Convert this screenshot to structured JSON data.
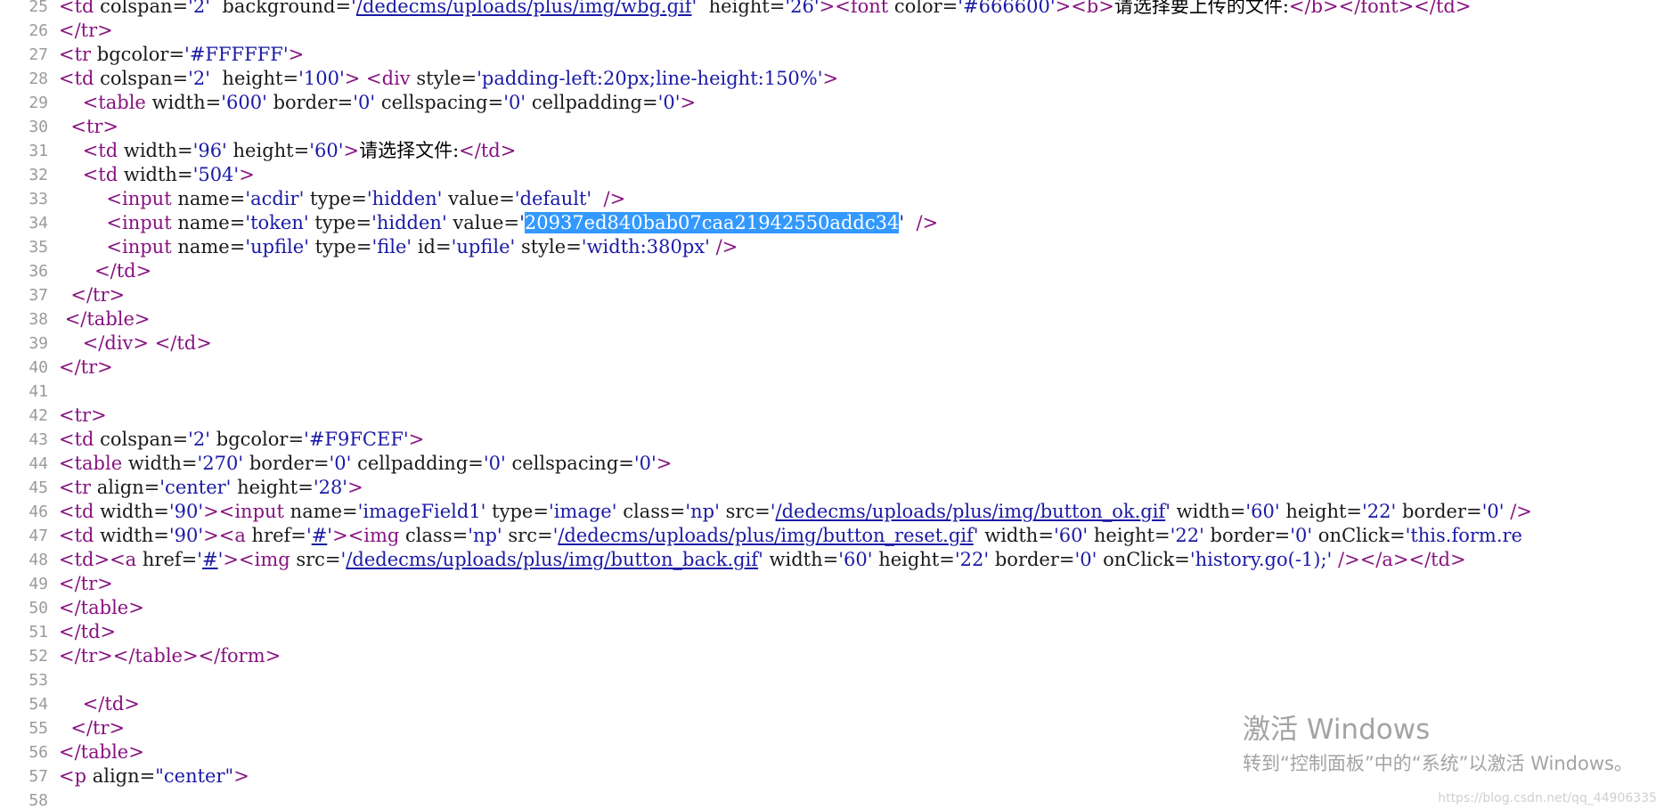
{
  "colors": {
    "tag": "#881280",
    "attribute": "#1a1a1a",
    "value": "#1a1aa6",
    "line_number": "#9a9a9a",
    "selection": "#3399ff",
    "watermark": "#a3a3a3"
  },
  "lines": [
    {
      "n": "25",
      "tokens": [
        [
          "tag",
          "<td "
        ],
        [
          "attr",
          "colspan="
        ],
        [
          "val",
          "'2'"
        ],
        [
          "text",
          "  "
        ],
        [
          "attr",
          "background="
        ],
        [
          "val",
          "'"
        ],
        [
          "link",
          "/dedecms/uploads/plus/img/wbg.gif"
        ],
        [
          "val",
          "'"
        ],
        [
          "text",
          "  "
        ],
        [
          "attr",
          "height="
        ],
        [
          "val",
          "'26'"
        ],
        [
          "tag",
          ">"
        ],
        [
          "tag",
          "<font "
        ],
        [
          "attr",
          "color="
        ],
        [
          "val",
          "'#666600'"
        ],
        [
          "tag",
          ">"
        ],
        [
          "tag",
          "<b>"
        ],
        [
          "text",
          "请选择要上传的文件:"
        ],
        [
          "tag",
          "</b>"
        ],
        [
          "tag",
          "</font>"
        ],
        [
          "tag",
          "</td>"
        ]
      ]
    },
    {
      "n": "26",
      "tokens": [
        [
          "tag",
          "</tr>"
        ]
      ]
    },
    {
      "n": "27",
      "tokens": [
        [
          "tag",
          "<tr "
        ],
        [
          "attr",
          "bgcolor="
        ],
        [
          "val",
          "'#FFFFFF'"
        ],
        [
          "tag",
          ">"
        ]
      ]
    },
    {
      "n": "28",
      "tokens": [
        [
          "tag",
          "<td "
        ],
        [
          "attr",
          "colspan="
        ],
        [
          "val",
          "'2'"
        ],
        [
          "text",
          "  "
        ],
        [
          "attr",
          "height="
        ],
        [
          "val",
          "'100'"
        ],
        [
          "tag",
          ">"
        ],
        [
          "text",
          " "
        ],
        [
          "tag",
          "<div "
        ],
        [
          "attr",
          "style="
        ],
        [
          "val",
          "'padding-left:20px;line-height:150%'"
        ],
        [
          "tag",
          ">"
        ]
      ]
    },
    {
      "n": "29",
      "tokens": [
        [
          "text",
          "    "
        ],
        [
          "tag",
          "<table "
        ],
        [
          "attr",
          "width="
        ],
        [
          "val",
          "'600'"
        ],
        [
          "text",
          " "
        ],
        [
          "attr",
          "border="
        ],
        [
          "val",
          "'0'"
        ],
        [
          "text",
          " "
        ],
        [
          "attr",
          "cellspacing="
        ],
        [
          "val",
          "'0'"
        ],
        [
          "text",
          " "
        ],
        [
          "attr",
          "cellpadding="
        ],
        [
          "val",
          "'0'"
        ],
        [
          "tag",
          ">"
        ]
      ]
    },
    {
      "n": "30",
      "tokens": [
        [
          "text",
          "  "
        ],
        [
          "tag",
          "<tr>"
        ]
      ]
    },
    {
      "n": "31",
      "tokens": [
        [
          "text",
          "    "
        ],
        [
          "tag",
          "<td "
        ],
        [
          "attr",
          "width="
        ],
        [
          "val",
          "'96'"
        ],
        [
          "text",
          " "
        ],
        [
          "attr",
          "height="
        ],
        [
          "val",
          "'60'"
        ],
        [
          "tag",
          ">"
        ],
        [
          "text",
          "请选择文件:"
        ],
        [
          "tag",
          "</td>"
        ]
      ]
    },
    {
      "n": "32",
      "tokens": [
        [
          "text",
          "    "
        ],
        [
          "tag",
          "<td "
        ],
        [
          "attr",
          "width="
        ],
        [
          "val",
          "'504'"
        ],
        [
          "tag",
          ">"
        ]
      ]
    },
    {
      "n": "33",
      "tokens": [
        [
          "text",
          "        "
        ],
        [
          "tag",
          "<input "
        ],
        [
          "attr",
          "name="
        ],
        [
          "val",
          "'acdir'"
        ],
        [
          "text",
          " "
        ],
        [
          "attr",
          "type="
        ],
        [
          "val",
          "'hidden'"
        ],
        [
          "text",
          " "
        ],
        [
          "attr",
          "value="
        ],
        [
          "val",
          "'default'"
        ],
        [
          "text",
          "  "
        ],
        [
          "tag",
          "/>"
        ]
      ]
    },
    {
      "n": "34",
      "tokens": [
        [
          "text",
          "        "
        ],
        [
          "tag",
          "<input "
        ],
        [
          "attr",
          "name="
        ],
        [
          "val",
          "'token'"
        ],
        [
          "text",
          " "
        ],
        [
          "attr",
          "type="
        ],
        [
          "val",
          "'hidden'"
        ],
        [
          "text",
          " "
        ],
        [
          "attr",
          "value="
        ],
        [
          "val",
          "'"
        ],
        [
          "sel",
          "20937ed840bab07caa21942550addc34"
        ],
        [
          "val",
          "'"
        ],
        [
          "text",
          "  "
        ],
        [
          "tag",
          "/>"
        ]
      ]
    },
    {
      "n": "35",
      "tokens": [
        [
          "text",
          "        "
        ],
        [
          "tag",
          "<input "
        ],
        [
          "attr",
          "name="
        ],
        [
          "val",
          "'upfile'"
        ],
        [
          "text",
          " "
        ],
        [
          "attr",
          "type="
        ],
        [
          "val",
          "'file'"
        ],
        [
          "text",
          " "
        ],
        [
          "attr",
          "id="
        ],
        [
          "val",
          "'upfile'"
        ],
        [
          "text",
          " "
        ],
        [
          "attr",
          "style="
        ],
        [
          "val",
          "'width:380px'"
        ],
        [
          "text",
          " "
        ],
        [
          "tag",
          "/>"
        ]
      ]
    },
    {
      "n": "36",
      "tokens": [
        [
          "text",
          "      "
        ],
        [
          "tag",
          "</td>"
        ]
      ]
    },
    {
      "n": "37",
      "tokens": [
        [
          "text",
          "  "
        ],
        [
          "tag",
          "</tr>"
        ]
      ]
    },
    {
      "n": "38",
      "tokens": [
        [
          "text",
          " "
        ],
        [
          "tag",
          "</table>"
        ]
      ]
    },
    {
      "n": "39",
      "tokens": [
        [
          "text",
          "    "
        ],
        [
          "tag",
          "</div>"
        ],
        [
          "text",
          " "
        ],
        [
          "tag",
          "</td>"
        ]
      ]
    },
    {
      "n": "40",
      "tokens": [
        [
          "tag",
          "</tr>"
        ]
      ]
    },
    {
      "n": "41",
      "tokens": []
    },
    {
      "n": "42",
      "tokens": [
        [
          "tag",
          "<tr>"
        ]
      ]
    },
    {
      "n": "43",
      "tokens": [
        [
          "tag",
          "<td "
        ],
        [
          "attr",
          "colspan="
        ],
        [
          "val",
          "'2'"
        ],
        [
          "text",
          " "
        ],
        [
          "attr",
          "bgcolor="
        ],
        [
          "val",
          "'#F9FCEF'"
        ],
        [
          "tag",
          ">"
        ]
      ]
    },
    {
      "n": "44",
      "tokens": [
        [
          "tag",
          "<table "
        ],
        [
          "attr",
          "width="
        ],
        [
          "val",
          "'270'"
        ],
        [
          "text",
          " "
        ],
        [
          "attr",
          "border="
        ],
        [
          "val",
          "'0'"
        ],
        [
          "text",
          " "
        ],
        [
          "attr",
          "cellpadding="
        ],
        [
          "val",
          "'0'"
        ],
        [
          "text",
          " "
        ],
        [
          "attr",
          "cellspacing="
        ],
        [
          "val",
          "'0'"
        ],
        [
          "tag",
          ">"
        ]
      ]
    },
    {
      "n": "45",
      "tokens": [
        [
          "tag",
          "<tr "
        ],
        [
          "attr",
          "align="
        ],
        [
          "val",
          "'center'"
        ],
        [
          "text",
          " "
        ],
        [
          "attr",
          "height="
        ],
        [
          "val",
          "'28'"
        ],
        [
          "tag",
          ">"
        ]
      ]
    },
    {
      "n": "46",
      "tokens": [
        [
          "tag",
          "<td "
        ],
        [
          "attr",
          "width="
        ],
        [
          "val",
          "'90'"
        ],
        [
          "tag",
          ">"
        ],
        [
          "tag",
          "<input "
        ],
        [
          "attr",
          "name="
        ],
        [
          "val",
          "'imageField1'"
        ],
        [
          "text",
          " "
        ],
        [
          "attr",
          "type="
        ],
        [
          "val",
          "'image'"
        ],
        [
          "text",
          " "
        ],
        [
          "attr",
          "class="
        ],
        [
          "val",
          "'np'"
        ],
        [
          "text",
          " "
        ],
        [
          "attr",
          "src="
        ],
        [
          "val",
          "'"
        ],
        [
          "link",
          "/dedecms/uploads/plus/img/button_ok.gif"
        ],
        [
          "val",
          "'"
        ],
        [
          "text",
          " "
        ],
        [
          "attr",
          "width="
        ],
        [
          "val",
          "'60'"
        ],
        [
          "text",
          " "
        ],
        [
          "attr",
          "height="
        ],
        [
          "val",
          "'22'"
        ],
        [
          "text",
          " "
        ],
        [
          "attr",
          "border="
        ],
        [
          "val",
          "'0'"
        ],
        [
          "text",
          " "
        ],
        [
          "tag",
          "/>"
        ]
      ]
    },
    {
      "n": "47",
      "tokens": [
        [
          "tag",
          "<td "
        ],
        [
          "attr",
          "width="
        ],
        [
          "val",
          "'90'"
        ],
        [
          "tag",
          ">"
        ],
        [
          "tag",
          "<a "
        ],
        [
          "attr",
          "href="
        ],
        [
          "val",
          "'"
        ],
        [
          "link",
          "#"
        ],
        [
          "val",
          "'"
        ],
        [
          "tag",
          ">"
        ],
        [
          "tag",
          "<img "
        ],
        [
          "attr",
          "class="
        ],
        [
          "val",
          "'np'"
        ],
        [
          "text",
          " "
        ],
        [
          "attr",
          "src="
        ],
        [
          "val",
          "'"
        ],
        [
          "link",
          "/dedecms/uploads/plus/img/button_reset.gif"
        ],
        [
          "val",
          "'"
        ],
        [
          "text",
          " "
        ],
        [
          "attr",
          "width="
        ],
        [
          "val",
          "'60'"
        ],
        [
          "text",
          " "
        ],
        [
          "attr",
          "height="
        ],
        [
          "val",
          "'22'"
        ],
        [
          "text",
          " "
        ],
        [
          "attr",
          "border="
        ],
        [
          "val",
          "'0'"
        ],
        [
          "text",
          " "
        ],
        [
          "attr",
          "onClick="
        ],
        [
          "val",
          "'this.form.re"
        ]
      ]
    },
    {
      "n": "48",
      "tokens": [
        [
          "tag",
          "<td>"
        ],
        [
          "tag",
          "<a "
        ],
        [
          "attr",
          "href="
        ],
        [
          "val",
          "'"
        ],
        [
          "link",
          "#"
        ],
        [
          "val",
          "'"
        ],
        [
          "tag",
          ">"
        ],
        [
          "tag",
          "<img "
        ],
        [
          "attr",
          "src="
        ],
        [
          "val",
          "'"
        ],
        [
          "link",
          "/dedecms/uploads/plus/img/button_back.gif"
        ],
        [
          "val",
          "'"
        ],
        [
          "text",
          " "
        ],
        [
          "attr",
          "width="
        ],
        [
          "val",
          "'60'"
        ],
        [
          "text",
          " "
        ],
        [
          "attr",
          "height="
        ],
        [
          "val",
          "'22'"
        ],
        [
          "text",
          " "
        ],
        [
          "attr",
          "border="
        ],
        [
          "val",
          "'0'"
        ],
        [
          "text",
          " "
        ],
        [
          "attr",
          "onClick="
        ],
        [
          "val",
          "'history.go(-1);'"
        ],
        [
          "text",
          " "
        ],
        [
          "tag",
          "/>"
        ],
        [
          "tag",
          "</a>"
        ],
        [
          "tag",
          "</td>"
        ]
      ]
    },
    {
      "n": "49",
      "tokens": [
        [
          "tag",
          "</tr>"
        ]
      ]
    },
    {
      "n": "50",
      "tokens": [
        [
          "tag",
          "</table>"
        ]
      ]
    },
    {
      "n": "51",
      "tokens": [
        [
          "tag",
          "</td>"
        ]
      ]
    },
    {
      "n": "52",
      "tokens": [
        [
          "tag",
          "</tr>"
        ],
        [
          "tag",
          "</table>"
        ],
        [
          "tag",
          "</form>"
        ]
      ]
    },
    {
      "n": "53",
      "tokens": []
    },
    {
      "n": "54",
      "tokens": [
        [
          "text",
          "    "
        ],
        [
          "tag",
          "</td>"
        ]
      ]
    },
    {
      "n": "55",
      "tokens": [
        [
          "text",
          "  "
        ],
        [
          "tag",
          "</tr>"
        ]
      ]
    },
    {
      "n": "56",
      "tokens": [
        [
          "tag",
          "</table>"
        ]
      ]
    },
    {
      "n": "57",
      "tokens": [
        [
          "tag",
          "<p "
        ],
        [
          "attr",
          "align="
        ],
        [
          "val",
          "\"center\""
        ],
        [
          "tag",
          ">"
        ]
      ]
    },
    {
      "n": "58",
      "tokens": []
    }
  ],
  "watermark": {
    "title": "激活 Windows",
    "subtitle": "转到“控制面板”中的“系统”以激活 Windows。"
  },
  "credit": "https://blog.csdn.net/qq_44906335"
}
